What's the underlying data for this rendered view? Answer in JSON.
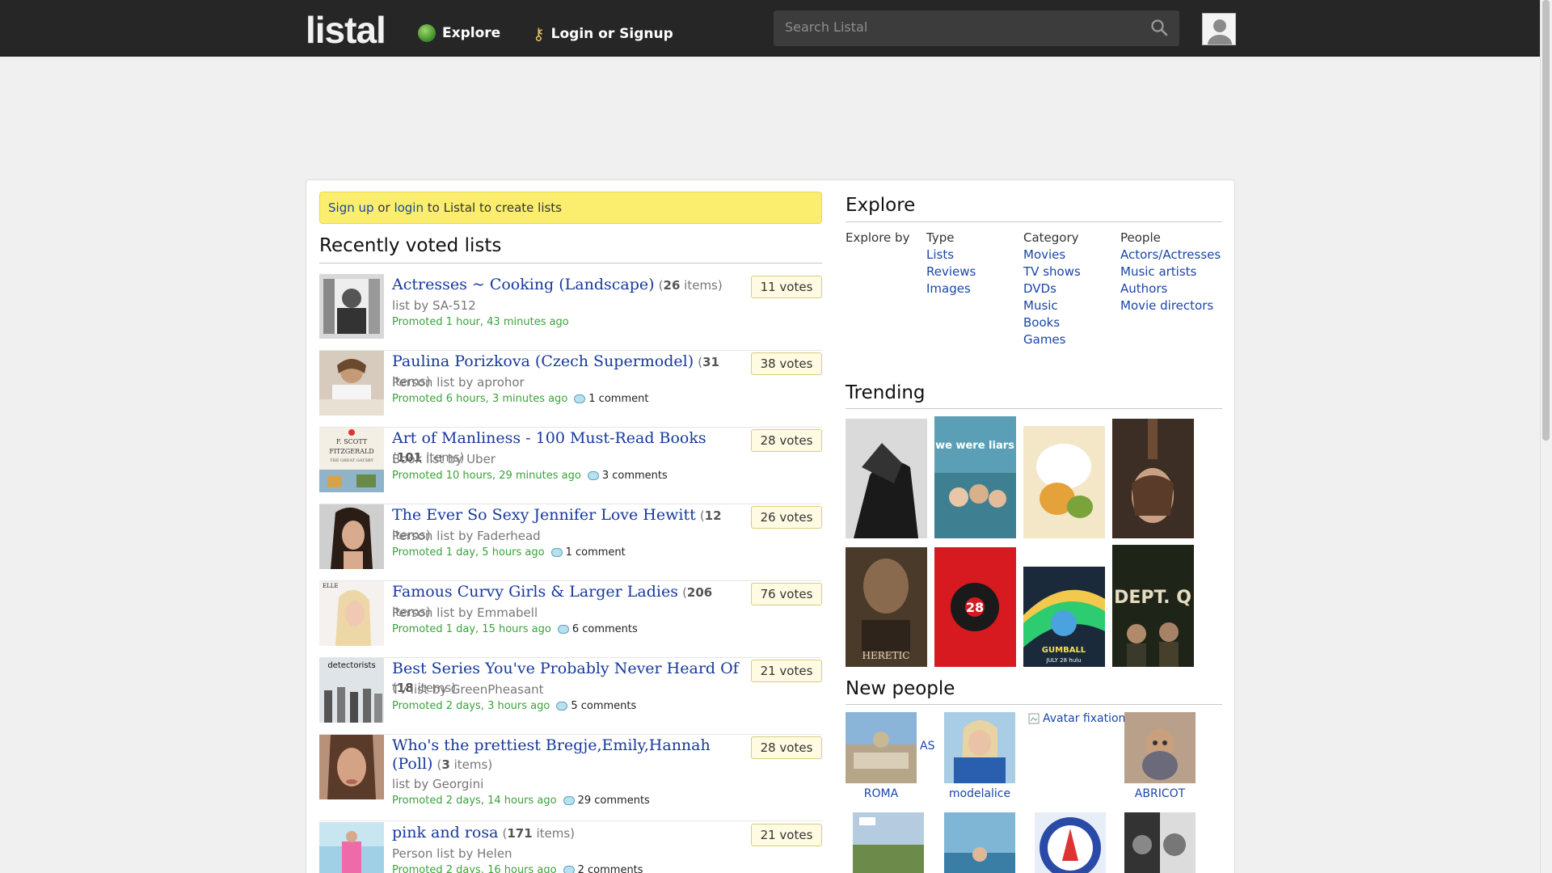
{
  "header": {
    "logo": "listal",
    "nav": [
      {
        "label": "Explore"
      },
      {
        "label": "Login or Signup"
      }
    ],
    "search_placeholder": "Search Listal"
  },
  "notice": {
    "signup": "Sign up",
    "or": "or",
    "login": "login",
    "rest": "to Listal to create lists"
  },
  "recent": {
    "title": "Recently voted lists",
    "items": [
      {
        "title": "Actresses ~ Cooking (Landscape)",
        "count": "26",
        "items_word": "items",
        "by": "list by SA-512",
        "promoted": "Promoted 1 hour, 43 minutes ago",
        "comments": "",
        "votes": "11 votes"
      },
      {
        "title": "Paulina Porizkova (Czech Supermodel)",
        "count": "31",
        "items_word": "items",
        "by": "Person list by aprohor",
        "promoted": "Promoted 6 hours, 3 minutes ago",
        "comments": "1 comment",
        "votes": "38 votes"
      },
      {
        "title": "Art of Manliness - 100 Must-Read Books",
        "count": "101",
        "items_word": "items",
        "by": "Book list by Uber",
        "promoted": "Promoted 10 hours, 29 minutes ago",
        "comments": "3 comments",
        "votes": "28 votes"
      },
      {
        "title": "The Ever So Sexy Jennifer Love Hewitt",
        "count": "12",
        "items_word": "items",
        "by": "Person list by Faderhead",
        "promoted": "Promoted 1 day, 5 hours ago",
        "comments": "1 comment",
        "votes": "26 votes"
      },
      {
        "title": "Famous Curvy Girls & Larger Ladies",
        "count": "206",
        "items_word": "items",
        "by": "Person list by Emmabell",
        "promoted": "Promoted 1 day, 15 hours ago",
        "comments": "6 comments",
        "votes": "76 votes"
      },
      {
        "title": "Best Series You've Probably Never Heard Of",
        "count": "18",
        "items_word": "items",
        "by": "Tv list by GreenPheasant",
        "promoted": "Promoted 2 days, 3 hours ago",
        "comments": "5 comments",
        "votes": "21 votes"
      },
      {
        "title": "Who's the prettiest Bregje,Emily,Hannah (Poll)",
        "count": "3",
        "items_word": "items",
        "by": "list by Georgini",
        "promoted": "Promoted 2 days, 14 hours ago",
        "comments": "29 comments",
        "votes": "28 votes"
      },
      {
        "title": "pink and rosa",
        "count": "171",
        "items_word": "items",
        "by": "Person list by Helen",
        "promoted": "Promoted 2 days, 16 hours ago",
        "comments": "2 comments",
        "votes": "21 votes"
      }
    ],
    "thumb_text": {
      "fitz_1": "F. SCOTT",
      "fitz_2": "FITZGERALD",
      "fitz_3": "THE GREAT GATSBY",
      "elle": "ELLE",
      "detect": "detectorists"
    }
  },
  "explore": {
    "title": "Explore",
    "by_label": "Explore by",
    "columns": [
      {
        "heading": "Type",
        "links": [
          "Lists",
          "Reviews",
          "Images"
        ]
      },
      {
        "heading": "Category",
        "links": [
          "Movies",
          "TV shows",
          "DVDs",
          "Music",
          "Books",
          "Games"
        ]
      },
      {
        "heading": "People",
        "links": [
          "Actors/Actresses",
          "Music artists",
          "Authors",
          "Movie directors"
        ]
      }
    ]
  },
  "trending": {
    "title": "Trending",
    "poster_text": {
      "p2": "we were liars",
      "p5": "HERETIC",
      "p6": "28",
      "p7": "GUMBALL",
      "p7b": "JULY 28 hulu",
      "p8": "DEPT. Q"
    }
  },
  "new_people": {
    "title": "New people",
    "people": [
      {
        "name": "ROMA",
        "tag": "AS"
      },
      {
        "name": "modelalice"
      },
      {
        "name": "fixation",
        "alt": "Avatar fixation"
      },
      {
        "name": "ABRICOT"
      }
    ]
  },
  "colors": {
    "link": "#1a46a8",
    "promoted": "#3aa23a",
    "notice_bg": "#fbee6f",
    "topbar": "#262626"
  }
}
